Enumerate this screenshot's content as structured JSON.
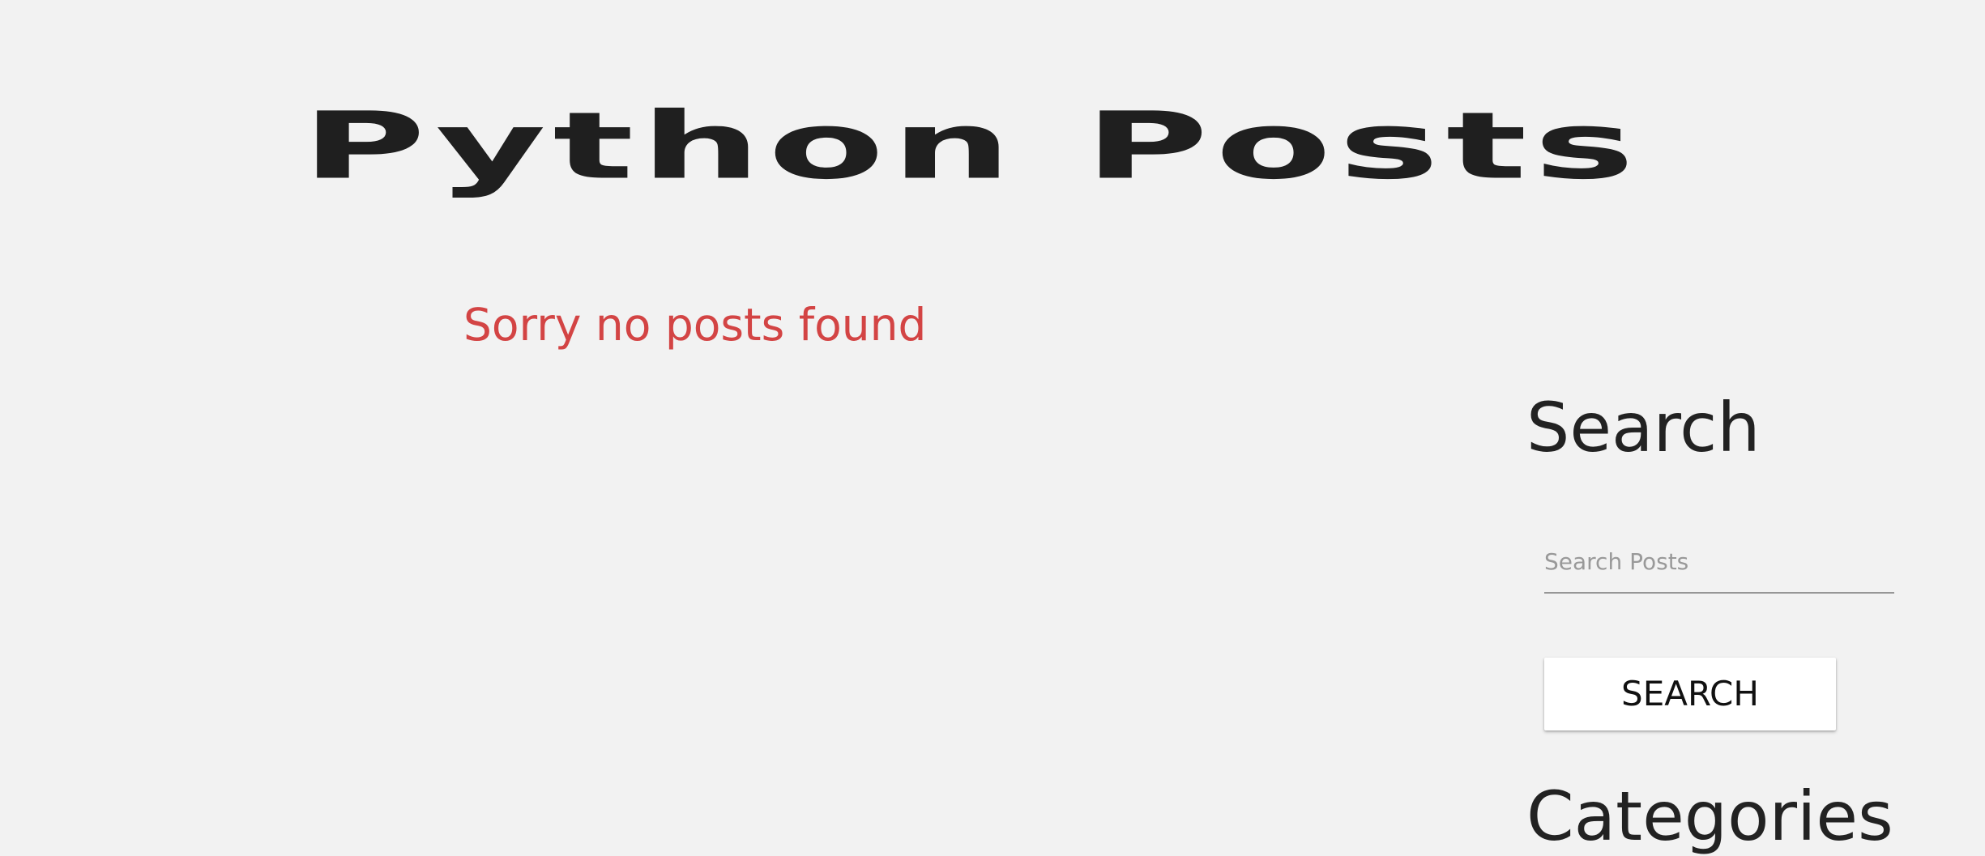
{
  "page": {
    "title": "Python Posts"
  },
  "content": {
    "empty_message": "Sorry no posts found",
    "empty_message_color": "#d34444"
  },
  "sidebar": {
    "search_heading": "Search",
    "search_placeholder": "Search Posts",
    "search_button_label": "SEARCH",
    "categories_heading": "Categories"
  },
  "colors": {
    "background": "#f2f2f2",
    "text": "#222222",
    "button_background": "#ffffff"
  }
}
